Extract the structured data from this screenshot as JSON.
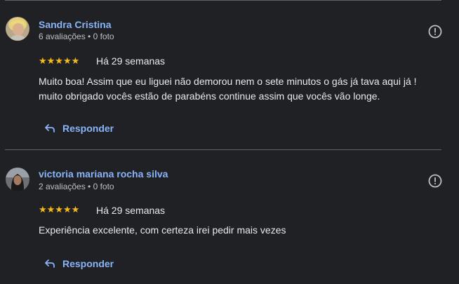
{
  "colors": {
    "background": "#202124",
    "link": "#8ab4f8",
    "star": "#fbbc04",
    "text": "#e8eaed",
    "muted": "#bdc1c6",
    "divider": "#5f6368"
  },
  "reviews": [
    {
      "name": "Sandra Cristina",
      "meta": "6 avaliações • 0 foto",
      "stars": "★★★★★",
      "rating": 5,
      "time": "Há 29 semanas",
      "text": "Muito boa! Assim que eu liguei não demorou nem o sete minutos o gás já tava aqui já ! muito obrigado vocês estão de parabéns continue assim que vocês vão longe.",
      "reply_label": "Responder",
      "report_icon": "report-icon",
      "avatar_icon": "avatar-photo"
    },
    {
      "name": "victoria mariana rocha silva",
      "meta": "2 avaliações • 0 foto",
      "stars": "★★★★★",
      "rating": 5,
      "time": "Há 29 semanas",
      "text": "Experiência excelente, com certeza irei pedir mais vezes",
      "reply_label": "Responder",
      "report_icon": "report-icon",
      "avatar_icon": "avatar-photo"
    }
  ]
}
